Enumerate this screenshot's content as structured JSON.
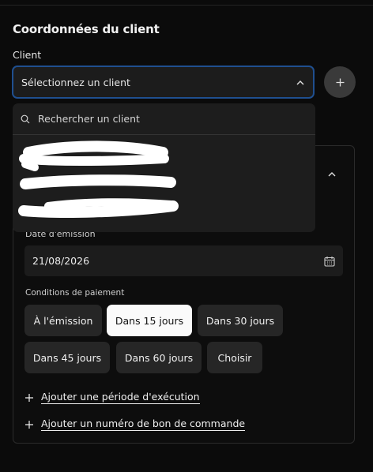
{
  "section": {
    "title": "Coordonnées du client"
  },
  "client": {
    "label": "Client",
    "select_placeholder": "Sélectionnez un client",
    "search_placeholder": "Rechercher un client",
    "add_icon": "plus-icon"
  },
  "invoice": {
    "date_label": "Date d'émission",
    "date_value": "21/08/2026",
    "payment_label": "Conditions de paiement",
    "payment_options": [
      "À l'émission",
      "Dans 15 jours",
      "Dans 30 jours",
      "Dans 45 jours",
      "Dans 60 jours",
      "Choisir"
    ],
    "selected_payment": "Dans 15 jours",
    "add_period_link": "Ajouter une période d'exécution",
    "add_po_link": "Ajouter un numéro de bon de commande"
  },
  "colors": {
    "focus_border": "#1f4f8f",
    "selected_pill": "#fafafa",
    "pill": "#262626"
  }
}
